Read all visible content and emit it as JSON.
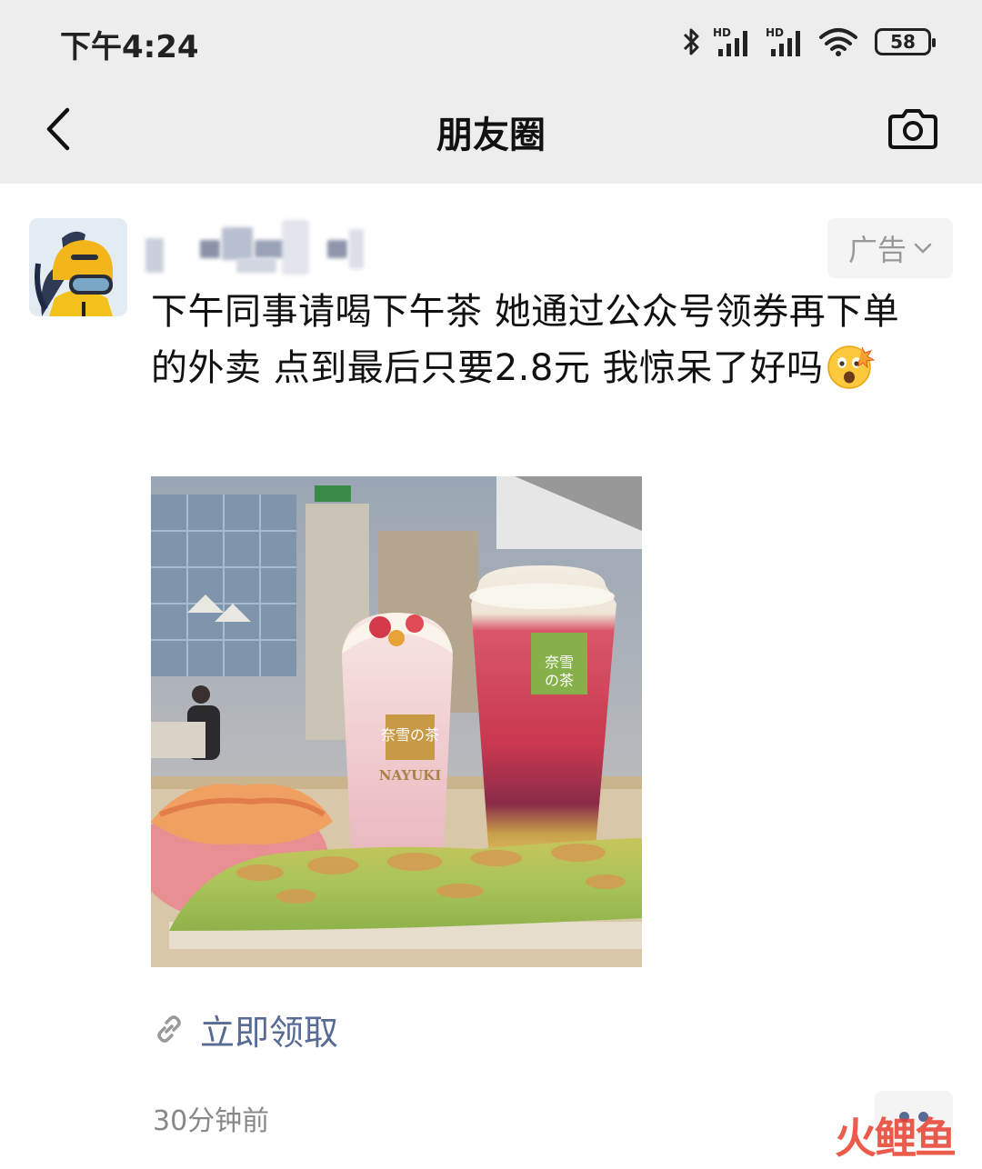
{
  "status_bar": {
    "time": "下午4:24",
    "battery": "58",
    "network_label_1": "HD",
    "network_label_2": "HD",
    "icons": [
      "bluetooth-icon",
      "signal-hd-icon",
      "signal-hd-icon",
      "wifi-icon",
      "battery-icon"
    ]
  },
  "nav": {
    "title": "朋友圈",
    "back_icon": "chevron-left-icon",
    "camera_icon": "camera-icon"
  },
  "post": {
    "ad_label": "广告",
    "text": "下午同事请喝下午茶 她通过公众号领券再下单的外卖 点到最后只要2.8元 我惊呆了好吗",
    "emoji": "astonished-emoji",
    "photo": {
      "cup_brand_text": "奈雪の茶",
      "cup_brand_latin": "NAYUKI"
    },
    "link_label": "立即领取",
    "link_icon": "link-icon",
    "time_ago": "30分钟前",
    "more_icon": "more-dots-icon"
  },
  "watermark": "火鲤鱼",
  "colors": {
    "bar_bg": "#ededed",
    "link": "#576b95",
    "meta_gray": "#888888",
    "ad_tag_bg": "#f4f4f4"
  }
}
